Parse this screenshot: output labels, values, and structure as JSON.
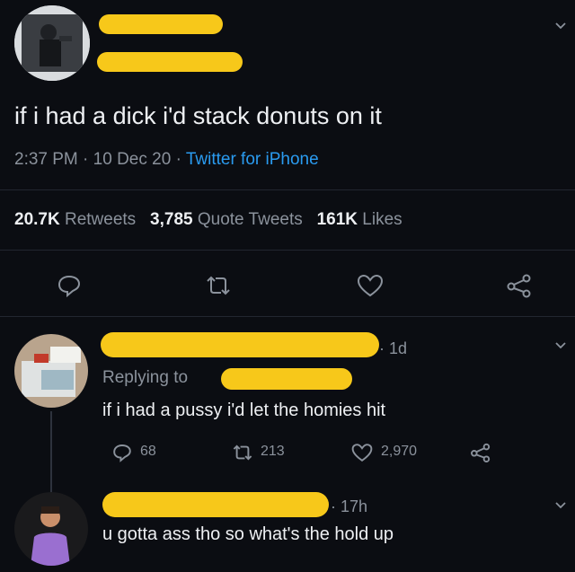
{
  "colors": {
    "background": "#0b0d12",
    "text": "#e8eaee",
    "muted": "#8b929c",
    "link": "#2a9bf0",
    "redaction": "#f7c81a"
  },
  "main_tweet": {
    "text": "if i had a dick i'd stack donuts on it",
    "time": "2:37 PM",
    "date": "10 Dec 20",
    "separator": "·",
    "source": "Twitter for iPhone",
    "stats": {
      "retweets_count": "20.7K",
      "retweets_label": "Retweets",
      "quotes_count": "3,785",
      "quotes_label": "Quote Tweets",
      "likes_count": "161K",
      "likes_label": "Likes"
    },
    "actions": [
      "reply-icon",
      "retweet-icon",
      "like-icon",
      "share-icon"
    ]
  },
  "replies": [
    {
      "age": "· 1d",
      "replying_to_label": "Replying to",
      "text": "if i had a pussy i'd let the homies hit",
      "reply_count": "68",
      "retweet_count": "213",
      "like_count": "2,970"
    },
    {
      "age": "· 17h",
      "text": "u gotta ass tho so what's the hold up"
    }
  ]
}
